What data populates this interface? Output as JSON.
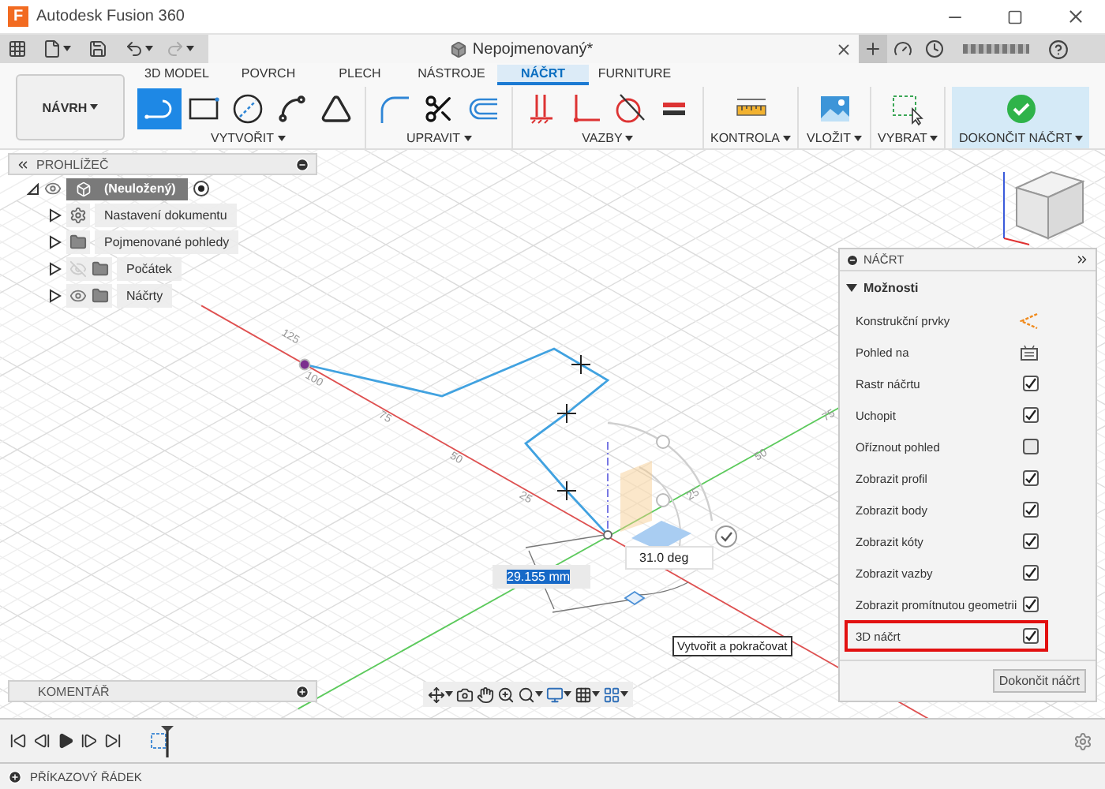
{
  "window": {
    "logo": "F",
    "title": "Autodesk Fusion 360"
  },
  "document_tab": {
    "title": "Nepojmenovaný*"
  },
  "ribbon": {
    "workspace": "NÁVRH",
    "tabs": [
      {
        "label": "3D MODEL",
        "selected": false
      },
      {
        "label": "POVRCH",
        "selected": false
      },
      {
        "label": "PLECH",
        "selected": false
      },
      {
        "label": "NÁSTROJE",
        "selected": false
      },
      {
        "label": "NÁČRT",
        "selected": true
      },
      {
        "label": "FURNITURE",
        "selected": false
      }
    ],
    "groups": [
      {
        "label": "VYTVOŘIT",
        "accent": false,
        "tools": [
          {
            "kind": "line",
            "selected": true
          },
          {
            "kind": "rectangle",
            "selected": false
          },
          {
            "kind": "circle",
            "selected": false
          },
          {
            "kind": "spline",
            "selected": false
          },
          {
            "kind": "mirror",
            "selected": false
          }
        ]
      },
      {
        "label": "UPRAVIT",
        "accent": false,
        "tools": [
          {
            "kind": "fillet",
            "selected": false
          },
          {
            "kind": "trim",
            "selected": false
          },
          {
            "kind": "offset",
            "selected": false
          }
        ]
      },
      {
        "label": "VAZBY",
        "accent": false,
        "tools": [
          {
            "kind": "fix",
            "selected": false
          },
          {
            "kind": "perpendicular",
            "selected": false
          },
          {
            "kind": "tangent",
            "selected": false
          },
          {
            "kind": "equal",
            "selected": false
          }
        ]
      },
      {
        "label": "KONTROLA",
        "accent": false,
        "tools": [
          {
            "kind": "measure",
            "selected": false
          }
        ]
      },
      {
        "label": "VLOŽIT",
        "accent": false,
        "tools": [
          {
            "kind": "image",
            "selected": false
          }
        ]
      },
      {
        "label": "VYBRAT",
        "accent": false,
        "tools": [
          {
            "kind": "select",
            "selected": false
          }
        ]
      },
      {
        "label": "DOKONČIT NÁČRT",
        "accent": true,
        "tools": [
          {
            "kind": "finish",
            "selected": false
          }
        ]
      }
    ]
  },
  "browser": {
    "title": "PROHLÍŽEČ",
    "root": {
      "label": "(Neuložený)",
      "selected": true,
      "expanded": true,
      "visible": true,
      "active": true,
      "children": [
        {
          "label": "Nastavení dokumentu",
          "kind": "settings",
          "selected": false,
          "expanded": false
        },
        {
          "label": "Pojmenované pohledy",
          "kind": "folder",
          "selected": false,
          "expanded": false
        },
        {
          "label": "Počátek",
          "kind": "folder",
          "selected": false,
          "expanded": false,
          "visible": false
        },
        {
          "label": "Náčrty",
          "kind": "folder",
          "selected": false,
          "expanded": false,
          "visible": true
        }
      ]
    }
  },
  "canvas": {
    "red_axis_labels": [
      "125",
      "100",
      "75",
      "50",
      "25"
    ],
    "green_axis_labels": [
      "25",
      "50",
      "75"
    ],
    "length_input": {
      "value": "29.155 mm"
    },
    "angle_input": {
      "value": "31.0 deg"
    },
    "tooltip": "Vytvořit a pokračovat"
  },
  "sketch_palette": {
    "title": "NÁČRT",
    "section": {
      "label": "Možnosti",
      "expanded": true
    },
    "rows": [
      {
        "label": "Konstrukční prvky",
        "kind": "construction",
        "highlighted": false
      },
      {
        "label": "Pohled na",
        "kind": "look-at",
        "highlighted": false
      },
      {
        "label": "Rastr náčrtu",
        "kind": "checkbox",
        "checked": true,
        "highlighted": false
      },
      {
        "label": "Uchopit",
        "kind": "checkbox",
        "checked": true,
        "highlighted": false
      },
      {
        "label": "Oříznout pohled",
        "kind": "checkbox",
        "checked": false,
        "highlighted": false
      },
      {
        "label": "Zobrazit profil",
        "kind": "checkbox",
        "checked": true,
        "highlighted": false
      },
      {
        "label": "Zobrazit body",
        "kind": "checkbox",
        "checked": true,
        "highlighted": false
      },
      {
        "label": "Zobrazit kóty",
        "kind": "checkbox",
        "checked": true,
        "highlighted": false
      },
      {
        "label": "Zobrazit vazby",
        "kind": "checkbox",
        "checked": true,
        "highlighted": false
      },
      {
        "label": "Zobrazit promítnutou geometrii",
        "kind": "checkbox",
        "checked": true,
        "highlighted": false
      },
      {
        "label": "3D náčrt",
        "kind": "checkbox",
        "checked": true,
        "highlighted": true
      }
    ],
    "button": "Dokončit náčrt"
  },
  "comments": {
    "title": "KOMENTÁŘ"
  },
  "command_line": {
    "title": "PŘÍKAZOVÝ ŘÁDEK"
  }
}
